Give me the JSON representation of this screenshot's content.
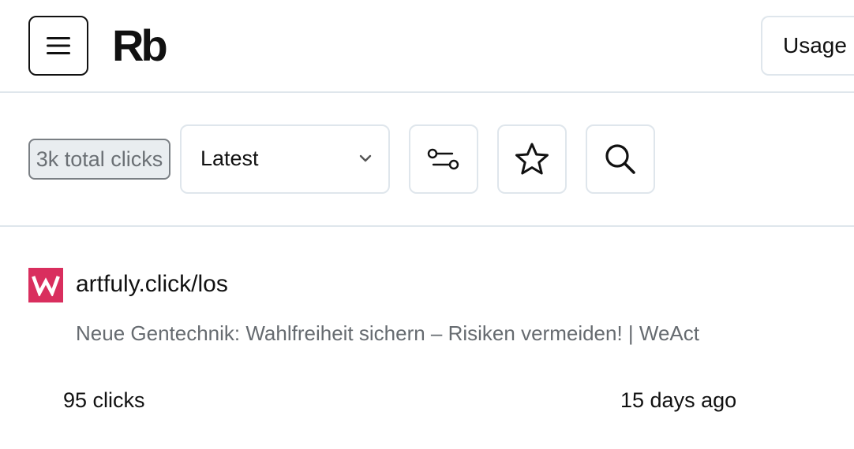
{
  "header": {
    "logo_text": "Rb",
    "usage_label": "Usage"
  },
  "toolbar": {
    "total_clicks": "3k total clicks",
    "sort": {
      "selected": "Latest"
    }
  },
  "links": [
    {
      "favicon_letter": "W",
      "favicon_color": "#d92e5e",
      "short_url": "artfuly.click/los",
      "title": "Neue Gentechnik: Wahlfreiheit sichern – Risiken vermeiden! | WeAct",
      "clicks": "95 clicks",
      "created": "15 days ago"
    }
  ],
  "icons": {
    "menu": "menu-icon",
    "filter": "filter-icon",
    "star": "star-icon",
    "search": "search-icon",
    "chevron": "chevron-down-icon"
  }
}
